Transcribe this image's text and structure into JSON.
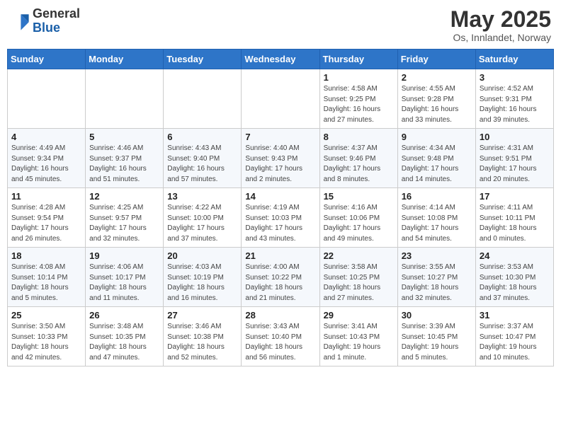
{
  "header": {
    "logo_general": "General",
    "logo_blue": "Blue",
    "month_title": "May 2025",
    "subtitle": "Os, Innlandet, Norway"
  },
  "weekdays": [
    "Sunday",
    "Monday",
    "Tuesday",
    "Wednesday",
    "Thursday",
    "Friday",
    "Saturday"
  ],
  "weeks": [
    [
      {
        "day": "",
        "info": ""
      },
      {
        "day": "",
        "info": ""
      },
      {
        "day": "",
        "info": ""
      },
      {
        "day": "",
        "info": ""
      },
      {
        "day": "1",
        "info": "Sunrise: 4:58 AM\nSunset: 9:25 PM\nDaylight: 16 hours\nand 27 minutes."
      },
      {
        "day": "2",
        "info": "Sunrise: 4:55 AM\nSunset: 9:28 PM\nDaylight: 16 hours\nand 33 minutes."
      },
      {
        "day": "3",
        "info": "Sunrise: 4:52 AM\nSunset: 9:31 PM\nDaylight: 16 hours\nand 39 minutes."
      }
    ],
    [
      {
        "day": "4",
        "info": "Sunrise: 4:49 AM\nSunset: 9:34 PM\nDaylight: 16 hours\nand 45 minutes."
      },
      {
        "day": "5",
        "info": "Sunrise: 4:46 AM\nSunset: 9:37 PM\nDaylight: 16 hours\nand 51 minutes."
      },
      {
        "day": "6",
        "info": "Sunrise: 4:43 AM\nSunset: 9:40 PM\nDaylight: 16 hours\nand 57 minutes."
      },
      {
        "day": "7",
        "info": "Sunrise: 4:40 AM\nSunset: 9:43 PM\nDaylight: 17 hours\nand 2 minutes."
      },
      {
        "day": "8",
        "info": "Sunrise: 4:37 AM\nSunset: 9:46 PM\nDaylight: 17 hours\nand 8 minutes."
      },
      {
        "day": "9",
        "info": "Sunrise: 4:34 AM\nSunset: 9:48 PM\nDaylight: 17 hours\nand 14 minutes."
      },
      {
        "day": "10",
        "info": "Sunrise: 4:31 AM\nSunset: 9:51 PM\nDaylight: 17 hours\nand 20 minutes."
      }
    ],
    [
      {
        "day": "11",
        "info": "Sunrise: 4:28 AM\nSunset: 9:54 PM\nDaylight: 17 hours\nand 26 minutes."
      },
      {
        "day": "12",
        "info": "Sunrise: 4:25 AM\nSunset: 9:57 PM\nDaylight: 17 hours\nand 32 minutes."
      },
      {
        "day": "13",
        "info": "Sunrise: 4:22 AM\nSunset: 10:00 PM\nDaylight: 17 hours\nand 37 minutes."
      },
      {
        "day": "14",
        "info": "Sunrise: 4:19 AM\nSunset: 10:03 PM\nDaylight: 17 hours\nand 43 minutes."
      },
      {
        "day": "15",
        "info": "Sunrise: 4:16 AM\nSunset: 10:06 PM\nDaylight: 17 hours\nand 49 minutes."
      },
      {
        "day": "16",
        "info": "Sunrise: 4:14 AM\nSunset: 10:08 PM\nDaylight: 17 hours\nand 54 minutes."
      },
      {
        "day": "17",
        "info": "Sunrise: 4:11 AM\nSunset: 10:11 PM\nDaylight: 18 hours\nand 0 minutes."
      }
    ],
    [
      {
        "day": "18",
        "info": "Sunrise: 4:08 AM\nSunset: 10:14 PM\nDaylight: 18 hours\nand 5 minutes."
      },
      {
        "day": "19",
        "info": "Sunrise: 4:06 AM\nSunset: 10:17 PM\nDaylight: 18 hours\nand 11 minutes."
      },
      {
        "day": "20",
        "info": "Sunrise: 4:03 AM\nSunset: 10:19 PM\nDaylight: 18 hours\nand 16 minutes."
      },
      {
        "day": "21",
        "info": "Sunrise: 4:00 AM\nSunset: 10:22 PM\nDaylight: 18 hours\nand 21 minutes."
      },
      {
        "day": "22",
        "info": "Sunrise: 3:58 AM\nSunset: 10:25 PM\nDaylight: 18 hours\nand 27 minutes."
      },
      {
        "day": "23",
        "info": "Sunrise: 3:55 AM\nSunset: 10:27 PM\nDaylight: 18 hours\nand 32 minutes."
      },
      {
        "day": "24",
        "info": "Sunrise: 3:53 AM\nSunset: 10:30 PM\nDaylight: 18 hours\nand 37 minutes."
      }
    ],
    [
      {
        "day": "25",
        "info": "Sunrise: 3:50 AM\nSunset: 10:33 PM\nDaylight: 18 hours\nand 42 minutes."
      },
      {
        "day": "26",
        "info": "Sunrise: 3:48 AM\nSunset: 10:35 PM\nDaylight: 18 hours\nand 47 minutes."
      },
      {
        "day": "27",
        "info": "Sunrise: 3:46 AM\nSunset: 10:38 PM\nDaylight: 18 hours\nand 52 minutes."
      },
      {
        "day": "28",
        "info": "Sunrise: 3:43 AM\nSunset: 10:40 PM\nDaylight: 18 hours\nand 56 minutes."
      },
      {
        "day": "29",
        "info": "Sunrise: 3:41 AM\nSunset: 10:43 PM\nDaylight: 19 hours\nand 1 minute."
      },
      {
        "day": "30",
        "info": "Sunrise: 3:39 AM\nSunset: 10:45 PM\nDaylight: 19 hours\nand 5 minutes."
      },
      {
        "day": "31",
        "info": "Sunrise: 3:37 AM\nSunset: 10:47 PM\nDaylight: 19 hours\nand 10 minutes."
      }
    ]
  ]
}
